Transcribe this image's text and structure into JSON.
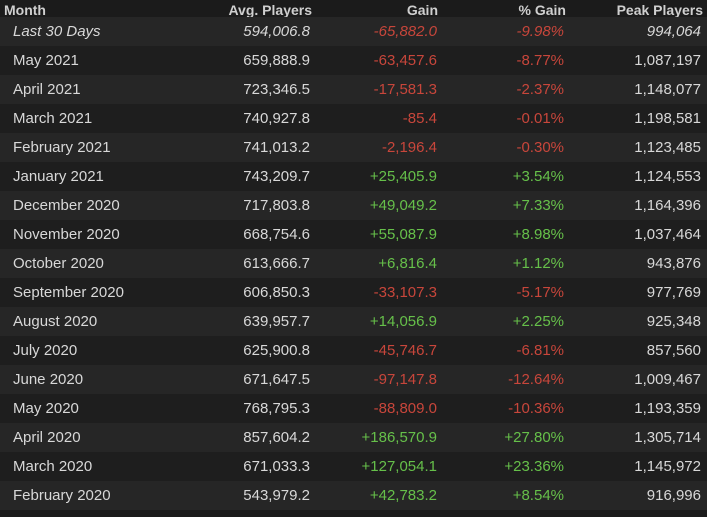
{
  "headers": {
    "month": "Month",
    "avg": "Avg. Players",
    "gain": "Gain",
    "pct": "% Gain",
    "peak": "Peak Players"
  },
  "colors": {
    "negative": "#c8463b",
    "positive": "#66c04a"
  },
  "rows": [
    {
      "month": "Last 30 Days",
      "avg": "594,006.8",
      "gain": "-65,882.0",
      "pct": "-9.98%",
      "peak": "994,064"
    },
    {
      "month": "May 2021",
      "avg": "659,888.9",
      "gain": "-63,457.6",
      "pct": "-8.77%",
      "peak": "1,087,197"
    },
    {
      "month": "April 2021",
      "avg": "723,346.5",
      "gain": "-17,581.3",
      "pct": "-2.37%",
      "peak": "1,148,077"
    },
    {
      "month": "March 2021",
      "avg": "740,927.8",
      "gain": "-85.4",
      "pct": "-0.01%",
      "peak": "1,198,581"
    },
    {
      "month": "February 2021",
      "avg": "741,013.2",
      "gain": "-2,196.4",
      "pct": "-0.30%",
      "peak": "1,123,485"
    },
    {
      "month": "January 2021",
      "avg": "743,209.7",
      "gain": "+25,405.9",
      "pct": "+3.54%",
      "peak": "1,124,553"
    },
    {
      "month": "December 2020",
      "avg": "717,803.8",
      "gain": "+49,049.2",
      "pct": "+7.33%",
      "peak": "1,164,396"
    },
    {
      "month": "November 2020",
      "avg": "668,754.6",
      "gain": "+55,087.9",
      "pct": "+8.98%",
      "peak": "1,037,464"
    },
    {
      "month": "October 2020",
      "avg": "613,666.7",
      "gain": "+6,816.4",
      "pct": "+1.12%",
      "peak": "943,876"
    },
    {
      "month": "September 2020",
      "avg": "606,850.3",
      "gain": "-33,107.3",
      "pct": "-5.17%",
      "peak": "977,769"
    },
    {
      "month": "August 2020",
      "avg": "639,957.7",
      "gain": "+14,056.9",
      "pct": "+2.25%",
      "peak": "925,348"
    },
    {
      "month": "July 2020",
      "avg": "625,900.8",
      "gain": "-45,746.7",
      "pct": "-6.81%",
      "peak": "857,560"
    },
    {
      "month": "June 2020",
      "avg": "671,647.5",
      "gain": "-97,147.8",
      "pct": "-12.64%",
      "peak": "1,009,467"
    },
    {
      "month": "May 2020",
      "avg": "768,795.3",
      "gain": "-88,809.0",
      "pct": "-10.36%",
      "peak": "1,193,359"
    },
    {
      "month": "April 2020",
      "avg": "857,604.2",
      "gain": "+186,570.9",
      "pct": "+27.80%",
      "peak": "1,305,714"
    },
    {
      "month": "March 2020",
      "avg": "671,033.3",
      "gain": "+127,054.1",
      "pct": "+23.36%",
      "peak": "1,145,972"
    },
    {
      "month": "February 2020",
      "avg": "543,979.2",
      "gain": "+42,783.2",
      "pct": "+8.54%",
      "peak": "916,996"
    }
  ]
}
